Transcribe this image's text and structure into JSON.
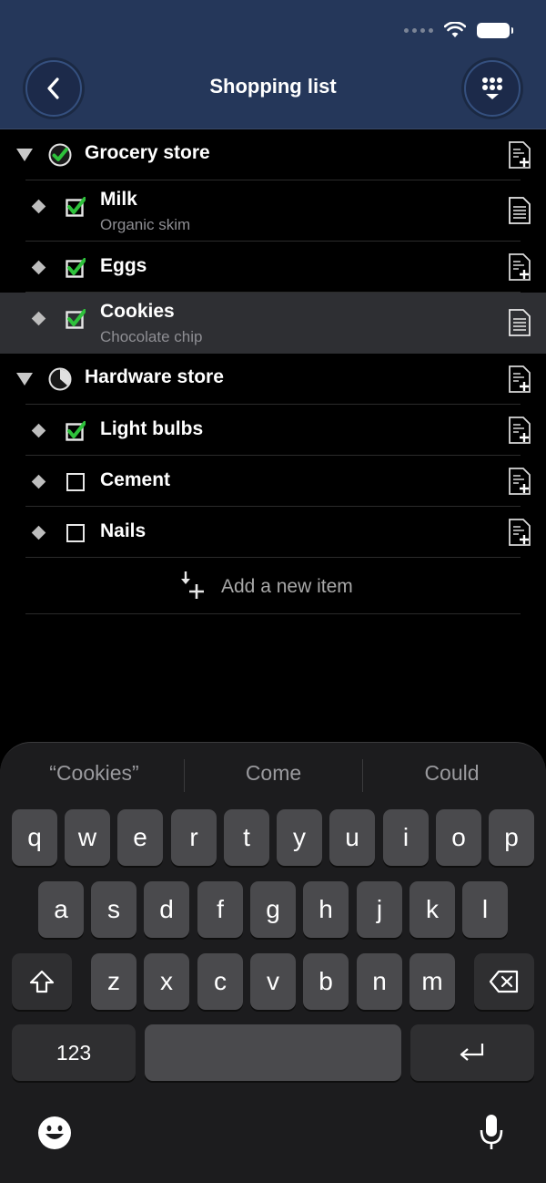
{
  "nav": {
    "title": "Shopping list",
    "back_icon": "chevron-left-icon",
    "menu_icon": "keypad-grid-icon"
  },
  "status_bar": {
    "signal_icon": "signal-dots-icon",
    "wifi_icon": "wifi-icon",
    "battery_icon": "battery-icon"
  },
  "groups": [
    {
      "title": "Grocery store",
      "status_icon": "green-check-circle-icon",
      "items": [
        {
          "title": "Milk",
          "note": "Organic skim",
          "checked": true
        },
        {
          "title": "Eggs",
          "note": "",
          "checked": true
        },
        {
          "title": "Cookies",
          "note": "Chocolate chip",
          "checked": true,
          "selected": true
        }
      ]
    },
    {
      "title": "Hardware store",
      "status_icon": "partial-progress-circle-icon",
      "items": [
        {
          "title": "Light bulbs",
          "note": "",
          "checked": true
        },
        {
          "title": "Cement",
          "note": "",
          "checked": false
        },
        {
          "title": "Nails",
          "note": "",
          "checked": false
        }
      ]
    }
  ],
  "add_item_label": "Add a new item",
  "keyboard": {
    "suggestions": [
      "“Cookies”",
      "Come",
      "Could"
    ],
    "row1": [
      "q",
      "w",
      "e",
      "r",
      "t",
      "y",
      "u",
      "i",
      "o",
      "p"
    ],
    "row2": [
      "a",
      "s",
      "d",
      "f",
      "g",
      "h",
      "j",
      "k",
      "l"
    ],
    "row3": [
      "z",
      "x",
      "c",
      "v",
      "b",
      "n",
      "m"
    ],
    "numbers_key": "123",
    "shift_icon": "shift-icon",
    "delete_icon": "backspace-icon",
    "return_icon": "return-icon",
    "emoji_icon": "emoji-icon",
    "mic_icon": "microphone-icon"
  },
  "colors": {
    "nav_bar": "#25375a",
    "check_green": "#2ec13b",
    "selected_row": "#2e2f33",
    "keyboard_bg": "#1c1c1e",
    "key_bg": "#4a4a4d"
  }
}
